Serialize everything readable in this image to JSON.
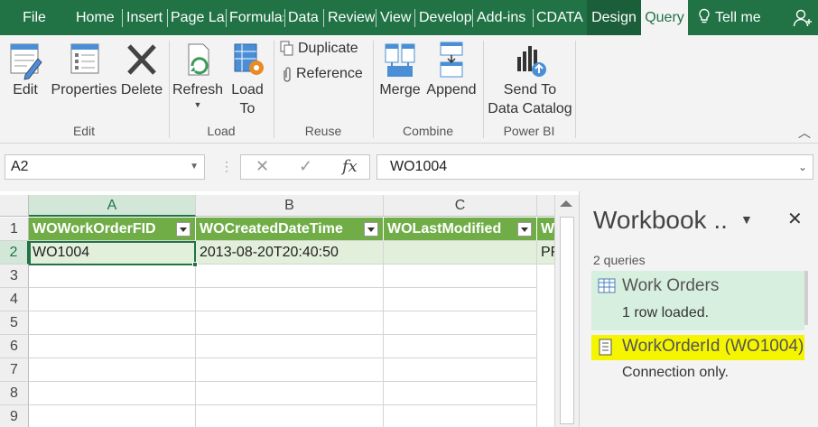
{
  "tabs": [
    {
      "id": "file",
      "label": "File"
    },
    {
      "id": "home",
      "label": "Home"
    },
    {
      "id": "insert",
      "label": "Insert"
    },
    {
      "id": "page-layout",
      "label": "Page Layout"
    },
    {
      "id": "formulas",
      "label": "Formulas"
    },
    {
      "id": "data",
      "label": "Data"
    },
    {
      "id": "review",
      "label": "Review"
    },
    {
      "id": "view",
      "label": "View"
    },
    {
      "id": "developer",
      "label": "Developer"
    },
    {
      "id": "add-ins",
      "label": "Add-ins"
    },
    {
      "id": "cdata",
      "label": "CDATA"
    },
    {
      "id": "design",
      "label": "Design"
    },
    {
      "id": "query",
      "label": "Query"
    }
  ],
  "tell_me": "Tell me",
  "ribbon": {
    "edit": {
      "label": "Edit"
    },
    "properties": {
      "label": "Properties"
    },
    "delete": {
      "label": "Delete"
    },
    "refresh": {
      "label": "Refresh"
    },
    "load_to": {
      "line1": "Load",
      "line2": "To"
    },
    "duplicate": {
      "label": "Duplicate"
    },
    "reference": {
      "label": "Reference"
    },
    "merge": {
      "label": "Merge"
    },
    "append": {
      "label": "Append"
    },
    "send_to": {
      "line1": "Send To",
      "line2": "Data Catalog"
    },
    "groups": {
      "edit": "Edit",
      "load": "Load",
      "reuse": "Reuse",
      "combine": "Combine",
      "power_bi": "Power BI"
    }
  },
  "formula_bar": {
    "name_box": "A2",
    "fx": "fx",
    "formula": "WO1004"
  },
  "sheet": {
    "columns": [
      "A",
      "B",
      "C"
    ],
    "rows": [
      "1",
      "2",
      "3",
      "4",
      "5",
      "6",
      "7",
      "8",
      "9"
    ],
    "headers": [
      "WOWorkOrderFID",
      "WOCreatedDateTime",
      "WOLastModified",
      "W"
    ],
    "data_row": [
      "WO1004",
      "2013-08-20T20:40:50",
      "",
      "PF"
    ]
  },
  "queries_pane": {
    "title": "Workbook ..",
    "count": "2 queries",
    "items": [
      {
        "name": "Work Orders",
        "status": "1 row loaded."
      },
      {
        "name": "WorkOrderId (WO1004)",
        "status": "Connection only."
      }
    ]
  },
  "colors": {
    "accent": "#217346",
    "table_header": "#70ad47",
    "table_row": "#e2efda",
    "highlight": "#f5f500"
  }
}
